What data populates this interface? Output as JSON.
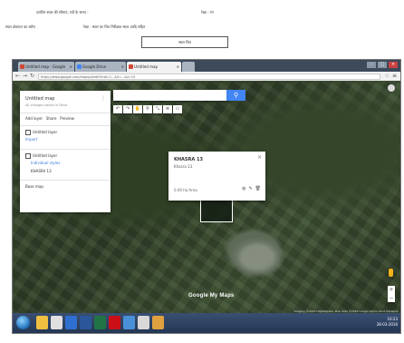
{
  "document": {
    "line1_left": "चयनित स्थल की सीमाएं, सर्वे के समय :",
    "line1_right": "रेखा :  रंग",
    "line2_left": "स्थल क्षेत्रफल का ब्यौरा",
    "line2_right": "रेखा :   स्थल का चित्र निरीक्षक स्थल आदि सहित",
    "box_label": "स्थल चित्र"
  },
  "browser": {
    "tabs": [
      {
        "label": "Untitled map - Google",
        "color": "#d14836"
      },
      {
        "label": "Google Drive",
        "color": "#4285f4"
      },
      {
        "label": "Untitled map",
        "color": "#d14836"
      },
      {
        "label": "",
        "color": "#888888"
      }
    ],
    "url": "https://www.google.com/maps/d/edit?mid=1...&ll=...&z=15",
    "back_icon": "back-arrow-icon",
    "forward_icon": "forward-arrow-icon",
    "reload_icon": "reload-icon"
  },
  "map": {
    "search_placeholder": "",
    "search_button_icon": "search-icon",
    "tools": [
      "↶",
      "↷",
      "✋",
      "⚲",
      "⤡",
      "≡",
      "▭"
    ],
    "panel": {
      "title": "Untitled map",
      "subtitle": "All changes saved in Drive",
      "actions": [
        "Add layer",
        "Share",
        "Preview"
      ],
      "layer_title": "Untitled layer",
      "layer_sub": "Import",
      "layer2_title": "Untitled layer",
      "layer2_style": "Individual styles",
      "feature_name": "KHASRA 13",
      "base_map": "Base map"
    },
    "popup": {
      "title": "KHASRA 13",
      "subtitle": "Khasra 13",
      "footer": "0.00 ha  Area"
    },
    "logo": "Google My Maps",
    "attribution": "Imagery ©2016 DigitalGlobe, Map data ©2016 Google   Terms   Send feedback",
    "zoom_in": "+",
    "zoom_out": "−"
  },
  "taskbar": {
    "icons": [
      {
        "name": "explorer-icon",
        "color": "#f0c040"
      },
      {
        "name": "chrome-icon",
        "color": "#e0e0e0"
      },
      {
        "name": "media-player-icon",
        "color": "#2f6fcf"
      },
      {
        "name": "word-icon",
        "color": "#2b579a"
      },
      {
        "name": "excel-icon",
        "color": "#217346"
      },
      {
        "name": "opera-icon",
        "color": "#cc0f16"
      },
      {
        "name": "app-icon",
        "color": "#4a90d9"
      },
      {
        "name": "chrome-active-icon",
        "color": "#d8d8d8"
      },
      {
        "name": "paint-icon",
        "color": "#e0a040"
      }
    ],
    "time": "10:23",
    "date": "28-03-2016"
  }
}
